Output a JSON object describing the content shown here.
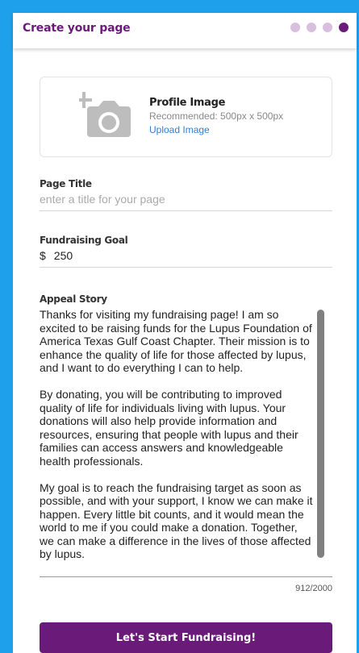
{
  "header": {
    "title": "Create your page",
    "steps": [
      {
        "active": false
      },
      {
        "active": false
      },
      {
        "active": false
      },
      {
        "active": true
      }
    ]
  },
  "profile": {
    "title": "Profile Image",
    "recommendation": "Recommended: 500px x 500px",
    "upload_label": "Upload Image",
    "icon": "add-photo-icon"
  },
  "page_title_field": {
    "label": "Page Title",
    "placeholder": "enter a title for your page",
    "value": ""
  },
  "goal_field": {
    "label": "Fundraising Goal",
    "currency": "$",
    "value": "250"
  },
  "story_field": {
    "label": "Appeal Story",
    "text": "Thanks for visiting my fundraising page! I am so excited to be raising funds for the Lupus Foundation of America Texas Gulf Coast Chapter. Their mission is to enhance the quality of life for those affected by lupus, and I want to do everything I can to help.\n\nBy donating, you will be contributing to improved quality of life for individuals living with lupus. Your donations will also help provide information and resources, ensuring that people with lupus and their families can access answers and knowledgeable health professionals.\n\nMy goal is to reach the fundraising target as soon as possible, and with your support, I know we can make it happen. Every little bit counts, and it would mean the world to me if you could make a donation. Together, we can make a difference in the lives of those affected by lupus.\n\nThank you so much for your support, and I can't wait to",
    "counter": "912/2000"
  },
  "cta": {
    "label": "Let's Start Fundraising!"
  },
  "colors": {
    "brand_purple": "#6a1b7a",
    "step_inactive": "#d8bfe0",
    "frame_blue": "#1fa0ea",
    "link_blue": "#2e7fd6"
  }
}
